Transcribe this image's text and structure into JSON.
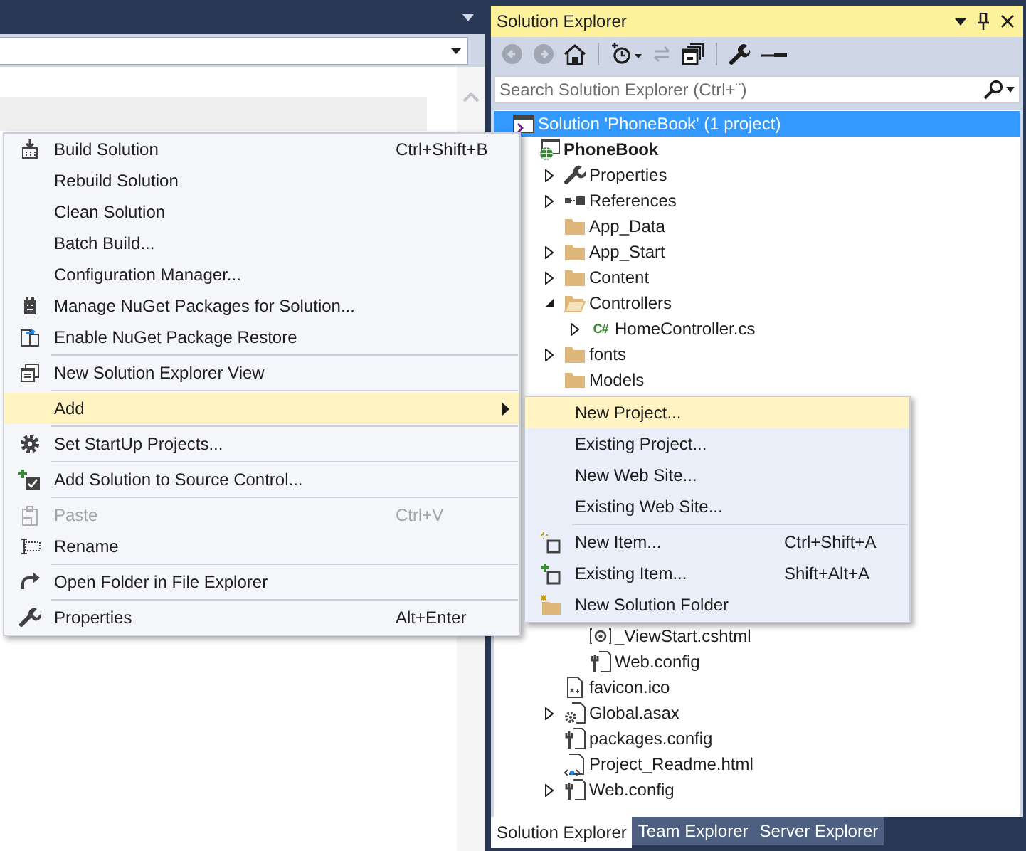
{
  "context_menu": {
    "items": [
      {
        "kind": "build",
        "label": "Build Solution",
        "shortcut": "Ctrl+Shift+B",
        "disabled": false,
        "selected": false
      },
      {
        "kind": "command",
        "label": "Rebuild Solution",
        "disabled": false,
        "selected": false
      },
      {
        "kind": "command",
        "label": "Clean Solution",
        "disabled": false,
        "selected": false
      },
      {
        "kind": "command",
        "label": "Batch Build...",
        "disabled": false,
        "selected": false
      },
      {
        "kind": "command",
        "label": "Configuration Manager...",
        "disabled": false,
        "selected": false
      },
      {
        "kind": "package",
        "label": "Manage NuGet Packages for Solution...",
        "disabled": false,
        "selected": false
      },
      {
        "kind": "restore",
        "label": "Enable NuGet Package Restore",
        "disabled": false,
        "selected": false
      },
      {
        "kind": "separator"
      },
      {
        "kind": "view",
        "label": "New Solution Explorer View",
        "disabled": false,
        "selected": false
      },
      {
        "kind": "separator"
      },
      {
        "kind": "submenu",
        "label": "Add",
        "disabled": false,
        "selected": true
      },
      {
        "kind": "separator"
      },
      {
        "kind": "gear",
        "label": "Set StartUp Projects...",
        "disabled": false,
        "selected": false
      },
      {
        "kind": "separator"
      },
      {
        "kind": "source",
        "label": "Add Solution to Source Control...",
        "disabled": false,
        "selected": false
      },
      {
        "kind": "separator"
      },
      {
        "kind": "paste",
        "label": "Paste",
        "shortcut": "Ctrl+V",
        "disabled": true,
        "selected": false
      },
      {
        "kind": "rename",
        "label": "Rename",
        "disabled": false,
        "selected": false
      },
      {
        "kind": "separator"
      },
      {
        "kind": "openfolder",
        "label": "Open Folder in File Explorer",
        "disabled": false,
        "selected": false
      },
      {
        "kind": "separator"
      },
      {
        "kind": "wrench",
        "label": "Properties",
        "shortcut": "Alt+Enter",
        "disabled": false,
        "selected": false
      }
    ]
  },
  "submenu": {
    "items": [
      {
        "kind": "command",
        "label": "New Project...",
        "disabled": false,
        "selected": true
      },
      {
        "kind": "command",
        "label": "Existing Project...",
        "disabled": false,
        "selected": false
      },
      {
        "kind": "command",
        "label": "New Web Site...",
        "disabled": false,
        "selected": false
      },
      {
        "kind": "command",
        "label": "Existing Web Site...",
        "disabled": false,
        "selected": false
      },
      {
        "kind": "separator"
      },
      {
        "kind": "newitem",
        "label": "New Item...",
        "shortcut": "Ctrl+Shift+A",
        "disabled": false,
        "selected": false
      },
      {
        "kind": "additem",
        "label": "Existing Item...",
        "shortcut": "Shift+Alt+A",
        "disabled": false,
        "selected": false
      },
      {
        "kind": "newfolder",
        "label": "New Solution Folder",
        "disabled": false,
        "selected": false
      }
    ]
  },
  "solution_explorer": {
    "title": "Solution Explorer",
    "search": {
      "placeholder": "Search Solution Explorer (Ctrl+¨)"
    },
    "tree": [
      {
        "kind": "solution",
        "label": "Solution 'PhoneBook' (1 project)",
        "expandable": false,
        "selected": true,
        "children": [
          {
            "kind": "project",
            "label": "PhoneBook",
            "expandable": false,
            "selected": false,
            "children": [
              {
                "kind": "properties",
                "label": "Properties",
                "expandable": true,
                "expanded": false,
                "selected": false
              },
              {
                "kind": "references",
                "label": "References",
                "expandable": true,
                "expanded": false,
                "selected": false
              },
              {
                "kind": "folder",
                "label": "App_Data",
                "expandable": false,
                "selected": false
              },
              {
                "kind": "folder",
                "label": "App_Start",
                "expandable": true,
                "expanded": false,
                "selected": false
              },
              {
                "kind": "folder",
                "label": "Content",
                "expandable": true,
                "expanded": false,
                "selected": false
              },
              {
                "kind": "folder",
                "label": "Controllers",
                "expandable": true,
                "expanded": true,
                "selected": false,
                "children": [
                  {
                    "kind": "csharp",
                    "badge": "C#",
                    "label": "HomeController.cs",
                    "expandable": true,
                    "expanded": false,
                    "selected": false
                  }
                ]
              },
              {
                "kind": "folder",
                "label": "fonts",
                "expandable": true,
                "expanded": false,
                "selected": false
              },
              {
                "kind": "folder",
                "label": "Models",
                "expandable": false,
                "selected": false
              },
              {
                "kind": "covered",
                "children": [
                  {
                    "kind": "razor",
                    "label": "_ViewStart.cshtml",
                    "expandable": false,
                    "selected": false
                  },
                  {
                    "kind": "config",
                    "label": "Web.config",
                    "expandable": false,
                    "selected": false
                  }
                ]
              },
              {
                "kind": "image",
                "label": "favicon.ico",
                "expandable": false,
                "selected": false
              },
              {
                "kind": "asax",
                "label": "Global.asax",
                "expandable": true,
                "expanded": false,
                "selected": false
              },
              {
                "kind": "config",
                "label": "packages.config",
                "expandable": false,
                "selected": false
              },
              {
                "kind": "html",
                "label": "Project_Readme.html",
                "expandable": false,
                "selected": false
              },
              {
                "kind": "config",
                "label": "Web.config",
                "expandable": true,
                "expanded": false,
                "selected": false
              }
            ]
          }
        ]
      }
    ],
    "tabs": [
      {
        "label": "Solution Explorer",
        "selected": true
      },
      {
        "label": "Team Explorer",
        "selected": false
      },
      {
        "label": "Server Explorer",
        "selected": false
      }
    ]
  }
}
